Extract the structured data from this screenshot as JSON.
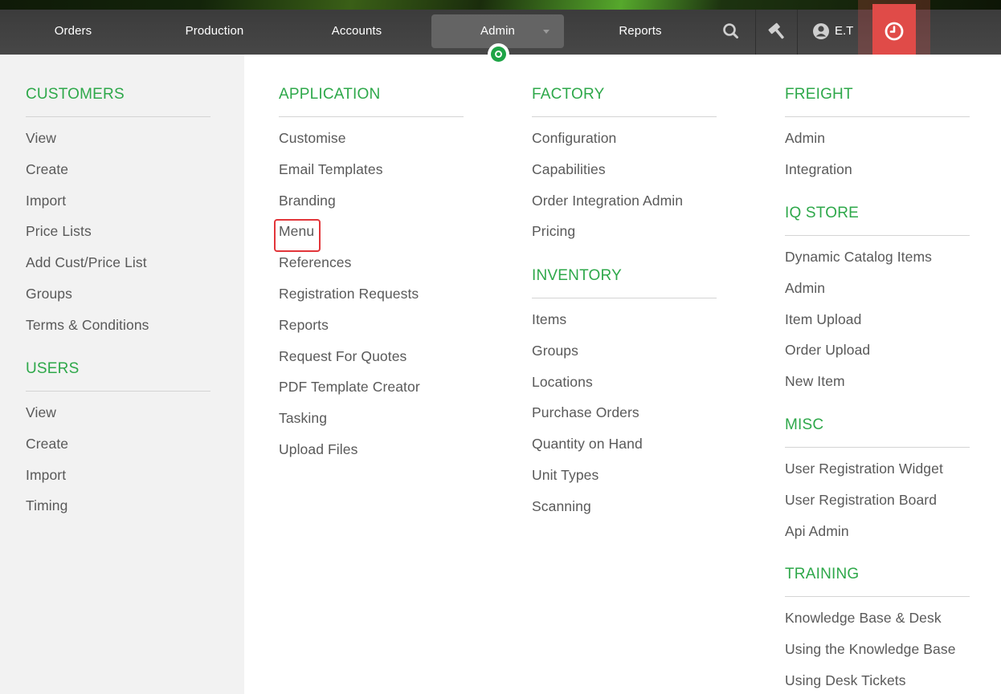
{
  "topnav": {
    "items": [
      "Orders",
      "Production",
      "Accounts",
      "Admin",
      "Reports"
    ],
    "user_initials": "E.T",
    "icons": {
      "search": "search-icon",
      "tools": "hammer-icon",
      "user": "user-avatar-icon",
      "clock": "clock-icon"
    },
    "colors": {
      "active_indicator": "#1ea446",
      "clock_button": "#e04b48"
    }
  },
  "menu": {
    "columns": [
      {
        "sections": [
          {
            "title": "CUSTOMERS",
            "items": [
              "View",
              "Create",
              "Import",
              "Price Lists",
              "Add Cust/Price List",
              "Groups",
              "Terms & Conditions"
            ]
          },
          {
            "title": "USERS",
            "items": [
              "View",
              "Create",
              "Import",
              "Timing"
            ]
          }
        ]
      },
      {
        "sections": [
          {
            "title": "APPLICATION",
            "items": [
              "Customise",
              "Email Templates",
              "Branding",
              "Menu",
              "References",
              "Registration Requests",
              "Reports",
              "Request For Quotes",
              "PDF Template Creator",
              "Tasking",
              "Upload Files"
            ]
          }
        ]
      },
      {
        "sections": [
          {
            "title": "FACTORY",
            "items": [
              "Configuration",
              "Capabilities",
              "Order Integration Admin",
              "Pricing"
            ]
          },
          {
            "title": "INVENTORY",
            "items": [
              "Items",
              "Groups",
              "Locations",
              "Purchase Orders",
              "Quantity on Hand",
              "Unit Types",
              "Scanning"
            ]
          }
        ]
      },
      {
        "sections": [
          {
            "title": "FREIGHT",
            "items": [
              "Admin",
              "Integration"
            ]
          },
          {
            "title": "IQ STORE",
            "items": [
              "Dynamic Catalog Items",
              "Admin",
              "Item Upload",
              "Order Upload",
              "New Item"
            ]
          },
          {
            "title": "MISC",
            "items": [
              "User Registration Widget",
              "User Registration Board",
              "Api Admin"
            ]
          },
          {
            "title": "TRAINING",
            "items": [
              "Knowledge Base & Desk",
              "Using the Knowledge Base",
              "Using Desk Tickets"
            ]
          }
        ]
      }
    ],
    "highlighted_item": "Menu",
    "colors": {
      "section_title": "#2ea84a",
      "item_text": "#595959",
      "highlight_border": "#e2353a"
    }
  }
}
